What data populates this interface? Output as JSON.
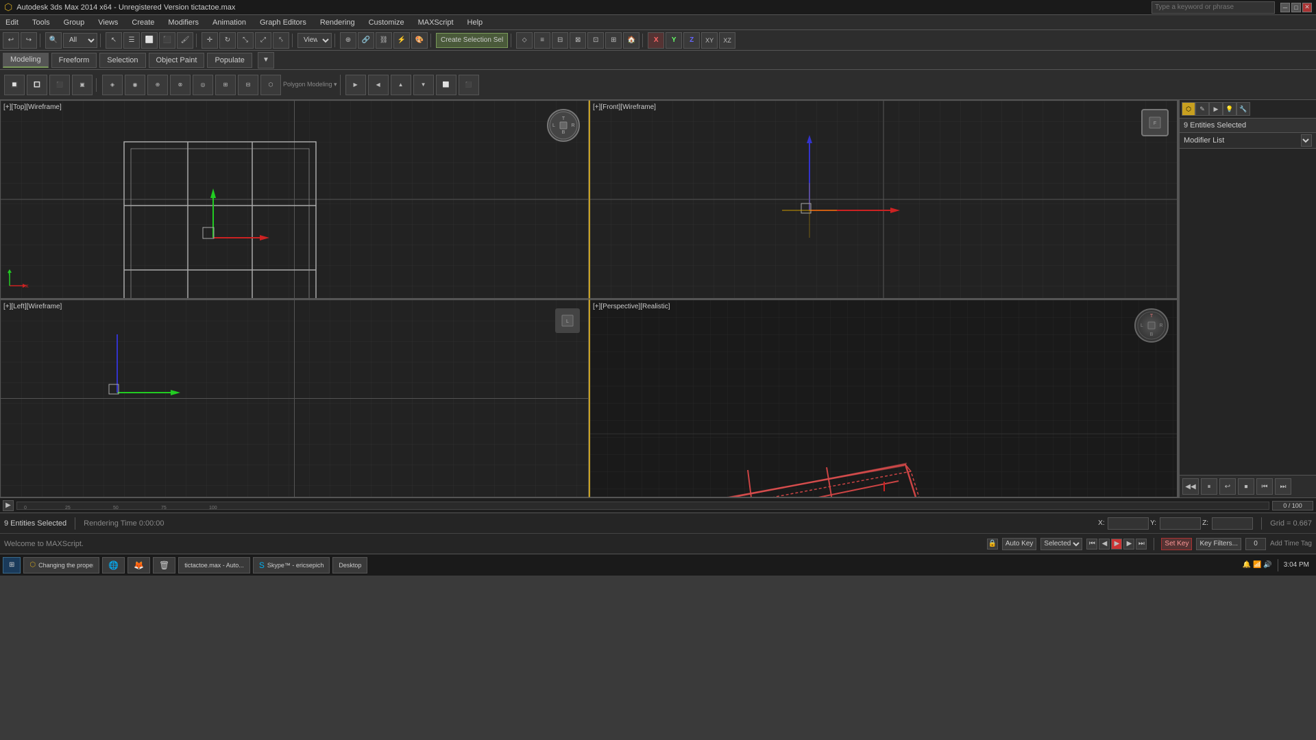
{
  "title_bar": {
    "title": "Autodesk 3ds Max 2014 x64 - Unregistered Version   tictactoe.max",
    "search_placeholder": "Type a keyword or phrase",
    "min": "─",
    "max": "□",
    "close": "✕"
  },
  "menu": {
    "items": [
      "Edit",
      "Tools",
      "Group",
      "Views",
      "Create",
      "Modifiers",
      "Animation",
      "Graph Editors",
      "Rendering",
      "Customize",
      "MAXScript",
      "Help"
    ]
  },
  "toolbar": {
    "dropdown_all": "All",
    "dropdown_view": "View",
    "create_sel_label": "Create Selection Sel"
  },
  "secondary_toolbar": {
    "tabs": [
      "Modeling",
      "Freeform",
      "Selection",
      "Object Paint",
      "Populate"
    ]
  },
  "ribbon": {
    "polygon_modeling_label": "Polygon Modeling ▾"
  },
  "viewports": {
    "top": {
      "label": "[+][Top][Wireframe]"
    },
    "front": {
      "label": "[+][Front][Wireframe]"
    },
    "left": {
      "label": "[+][Left][Wireframe]"
    },
    "perspective": {
      "label": "[+][Perspective][Realistic]"
    }
  },
  "right_panel": {
    "entities_selected": "9 Entities Selected",
    "modifier_list_label": "Modifier List",
    "tabs": [
      "★",
      "✏",
      "⬡",
      "⚙",
      "☰",
      "🔄"
    ]
  },
  "status_bar": {
    "entities_selected": "9 Entities Selected",
    "rendering_time": "Rendering Time  0:00:00",
    "x_label": "X:",
    "y_label": "Y:",
    "z_label": "Z:",
    "grid_label": "Grid = 0.667",
    "auto_key_label": "Auto Key",
    "selected_label": "Selected",
    "set_key_label": "Set Key",
    "key_filters_label": "Key Filters...",
    "time_display": "0 / 100",
    "status_text": "Welcome to MAXScript.",
    "add_time_tag": "Add Time Tag",
    "time_value": "0",
    "time_total": "100"
  },
  "taskbar": {
    "items": [
      "Changing the proper...",
      "Chrome",
      "Firefox",
      "Recycle Bin",
      "tictactoe.max - Auto...",
      "Skype™ - ericsepich",
      "Desktop"
    ],
    "time": "3:04 PM"
  },
  "colors": {
    "accent": "#c8a020",
    "grid": "#3a3a3a",
    "viewport_border": "#555",
    "selected_mesh": "#cc4444",
    "active_border": "#c8a020",
    "axis_x": "#cc3333",
    "axis_y": "#33cc33",
    "axis_z": "#3333cc"
  }
}
